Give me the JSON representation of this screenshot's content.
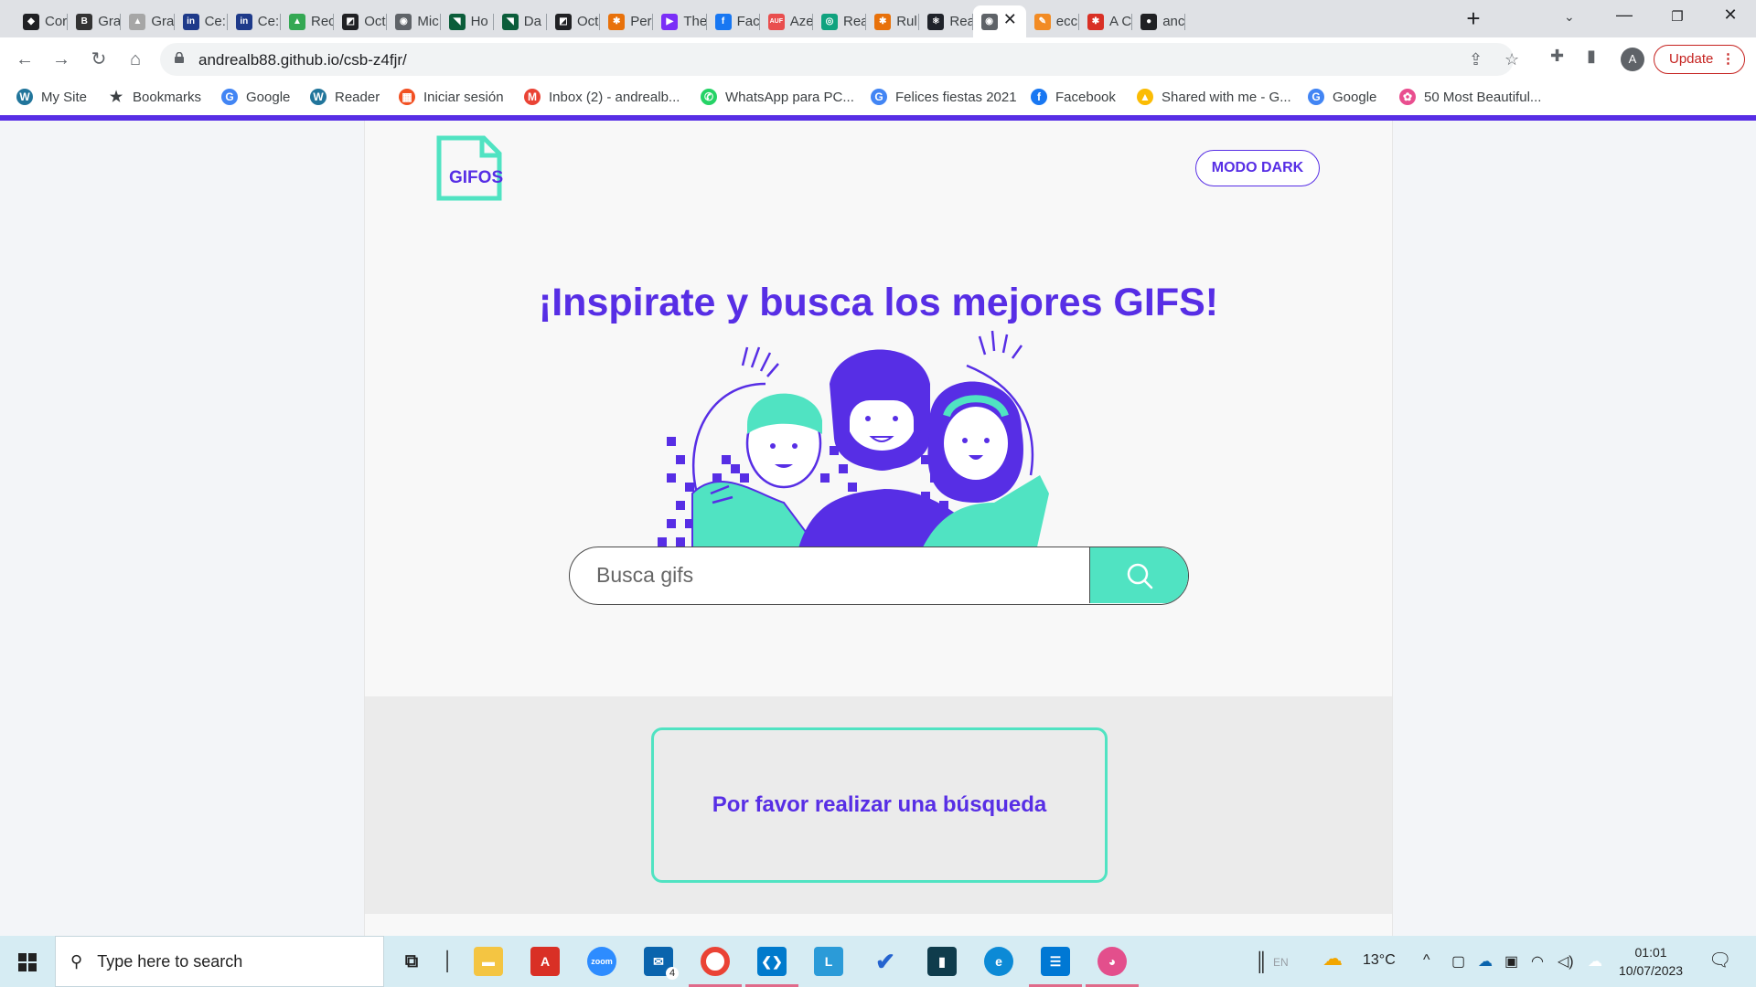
{
  "browser": {
    "tabs": [
      {
        "title": "Cor",
        "color": "#202124",
        "glyph": "◆"
      },
      {
        "title": "Gra",
        "color": "#333333",
        "glyph": "B"
      },
      {
        "title": "Gra",
        "color": "#a6a6a6",
        "glyph": "▲"
      },
      {
        "title": "Ce:",
        "color": "#1e3a8a",
        "glyph": "in"
      },
      {
        "title": "Ce:",
        "color": "#1e3a8a",
        "glyph": "in"
      },
      {
        "title": "Rec",
        "color": "#34a853",
        "glyph": "▲"
      },
      {
        "title": "Oct",
        "color": "#202124",
        "glyph": "◩"
      },
      {
        "title": "Mic",
        "color": "#5f6368",
        "glyph": "◉"
      },
      {
        "title": "Ho",
        "color": "#0b5d3a",
        "glyph": "◥"
      },
      {
        "title": "Da",
        "color": "#0b5d3a",
        "glyph": "◥"
      },
      {
        "title": "Oct",
        "color": "#202124",
        "glyph": "◩"
      },
      {
        "title": "Per",
        "color": "#e8710a",
        "glyph": "✱"
      },
      {
        "title": "The",
        "color": "#7b2ff7",
        "glyph": "▶"
      },
      {
        "title": "Fac",
        "color": "#1877f2",
        "glyph": "f"
      },
      {
        "title": "Aze",
        "color": "#e94e4e",
        "glyph": "AUF"
      },
      {
        "title": "Rea",
        "color": "#10a37f",
        "glyph": "◎"
      },
      {
        "title": "Rul",
        "color": "#e8710a",
        "glyph": "✱"
      },
      {
        "title": "Rea",
        "color": "#20232a",
        "glyph": "⚛"
      },
      {
        "title": "",
        "color": "#5f6368",
        "glyph": "◉"
      },
      {
        "title": "ecc",
        "color": "#f28b24",
        "glyph": "✎"
      },
      {
        "title": "A C",
        "color": "#d93025",
        "glyph": "✱"
      },
      {
        "title": "anc",
        "color": "#202124",
        "glyph": "●"
      }
    ],
    "active_tab_index": 18,
    "url": "andrealb88.github.io/csb-z4fjr/",
    "profile_initial": "A",
    "update_label": "Update"
  },
  "bookmarks": [
    {
      "label": "My Site",
      "icon": "wordpress-icon",
      "color": "#21759b",
      "glyph": "W"
    },
    {
      "label": "Bookmarks",
      "icon": "star-icon",
      "color": "#3c4043",
      "glyph": "★"
    },
    {
      "label": "Google",
      "icon": "google-icon",
      "color": "#4285f4",
      "glyph": "G"
    },
    {
      "label": "Reader",
      "icon": "wordpress-icon",
      "color": "#21759b",
      "glyph": "W"
    },
    {
      "label": "Iniciar sesión",
      "icon": "microsoft-icon",
      "color": "#f25022",
      "glyph": "▦"
    },
    {
      "label": "Inbox (2) - andrealb...",
      "icon": "gmail-icon",
      "color": "#ea4335",
      "glyph": "M"
    },
    {
      "label": "WhatsApp para PC...",
      "icon": "whatsapp-icon",
      "color": "#25d366",
      "glyph": "✆"
    },
    {
      "label": "Felices fiestas 2021",
      "icon": "google-icon",
      "color": "#4285f4",
      "glyph": "G"
    },
    {
      "label": "Facebook",
      "icon": "facebook-icon",
      "color": "#1877f2",
      "glyph": "f"
    },
    {
      "label": "Shared with me - G...",
      "icon": "drive-icon",
      "color": "#fbbc04",
      "glyph": "▲"
    },
    {
      "label": "Google",
      "icon": "google-icon",
      "color": "#4285f4",
      "glyph": "G"
    },
    {
      "label": "50 Most Beautiful...",
      "icon": "flower-icon",
      "color": "#e94e8f",
      "glyph": "✿"
    }
  ],
  "page": {
    "logo_text": "GIFOS",
    "dark_mode_button": "MODO DARK",
    "hero_title": "¡Inspirate y busca los mejores GIFS!",
    "search": {
      "placeholder": "Busca gifs",
      "value": ""
    },
    "empty_message": "Por favor realizar una búsqueda",
    "colors": {
      "accent": "#572ee5",
      "secondary": "#50e3c2"
    }
  },
  "taskbar": {
    "search_placeholder": "Type here to search",
    "apps": [
      "task-view",
      "file-explorer",
      "acrobat",
      "zoom",
      "mail",
      "chrome",
      "vscode",
      "libre",
      "todo",
      "notion",
      "edge",
      "azure",
      "paint"
    ],
    "mail_badge": "4",
    "weather": "13°C",
    "time": "01:01",
    "date": "10/07/2023",
    "language": "EN"
  }
}
